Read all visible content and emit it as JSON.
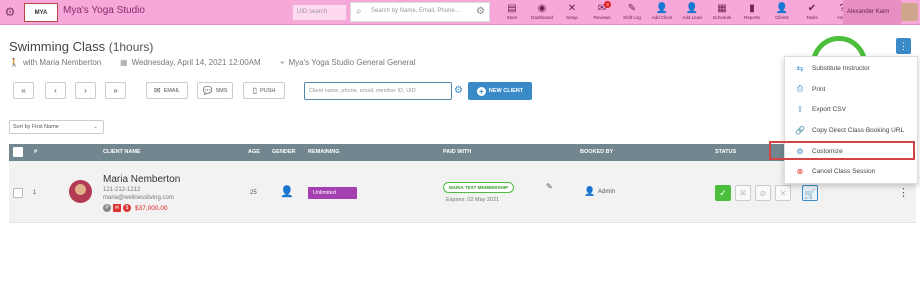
{
  "topbar": {
    "studio_name": "Mya's Yoga Studio",
    "logo_text": "MYA",
    "uid_placeholder": "UID search",
    "search_placeholder": "Search by Name, Email, Phone...",
    "nav": [
      {
        "label": "Store",
        "icon": "store-icon",
        "glyph": "▤"
      },
      {
        "label": "Dashboard",
        "icon": "dashboard-icon",
        "glyph": "◉"
      },
      {
        "label": "Setup",
        "icon": "setup-icon",
        "glyph": "✕"
      },
      {
        "label": "Reviews",
        "icon": "reviews-icon",
        "glyph": "✉",
        "badge": "3"
      },
      {
        "label": "Shift Log",
        "icon": "shift-log-icon",
        "glyph": "✎"
      },
      {
        "label": "Add Client",
        "icon": "add-client-icon",
        "glyph": "👤"
      },
      {
        "label": "Add Lead",
        "icon": "add-lead-icon",
        "glyph": "👤"
      },
      {
        "label": "Schedule",
        "icon": "schedule-icon",
        "glyph": "▦"
      },
      {
        "label": "Reports",
        "icon": "reports-icon",
        "glyph": "▮"
      },
      {
        "label": "Clients",
        "icon": "clients-icon",
        "glyph": "👤"
      },
      {
        "label": "Tasks",
        "icon": "tasks-icon",
        "glyph": "✔"
      },
      {
        "label": "Help",
        "icon": "help-icon",
        "glyph": "?"
      }
    ],
    "user_name": "Alexander Kaim"
  },
  "header": {
    "class_name": "Swimming Class",
    "duration": "(1hours)",
    "instructor": "with  Maria Nemberton",
    "date": "Wednesday, April 14, 2021 12:00AM",
    "location": "Mya's Yoga Studio General General"
  },
  "actions": {
    "email": "EMAIL",
    "sms": "SMS",
    "push": "PUSH",
    "client_placeholder": "Client name, phone, email, member ID, UID",
    "new_client": "NEW CLIENT"
  },
  "sort": {
    "selected": "Sort by First Name"
  },
  "table": {
    "headers": {
      "num": "#",
      "client_name": "CLIENT NAME",
      "age": "AGE",
      "gender": "GENDER",
      "remaining": "REMAINING",
      "paid_with": "PAID WITH",
      "booked_by": "BOOKED BY",
      "status": "STATUS"
    },
    "rows": [
      {
        "num": "1",
        "name": "Maria Nemberton",
        "phone": "121-212-1212",
        "email": "maria@wellnessliving.com",
        "amount": "$37,000.00",
        "age": "25",
        "remaining": "Unlimited",
        "membership": "MARIA TEST MEMBERSHIP",
        "expires": "Expires: 02 May 2021",
        "booked_by": "Admin"
      }
    ]
  },
  "menu": {
    "items": [
      {
        "label": "Substitute Instructor",
        "icon": "substitute-icon",
        "glyph": "⇆"
      },
      {
        "label": "Print",
        "icon": "print-icon",
        "glyph": "⎙"
      },
      {
        "label": "Export CSV",
        "icon": "export-icon",
        "glyph": "⇪"
      },
      {
        "label": "Copy Direct Class Booking URL",
        "icon": "link-icon",
        "glyph": "🔗"
      },
      {
        "label": "Customize",
        "icon": "gear-icon",
        "glyph": "⚙"
      },
      {
        "label": "Cancel Class Session",
        "icon": "cancel-icon",
        "glyph": "⊗"
      }
    ]
  },
  "colors": {
    "topbar": "#f7a8d8",
    "accent": "#3a8ac8",
    "table_header": "#72868f",
    "unlimited": "#a440b0",
    "highlight": "#d34545",
    "ring": "#4bbf3c"
  }
}
